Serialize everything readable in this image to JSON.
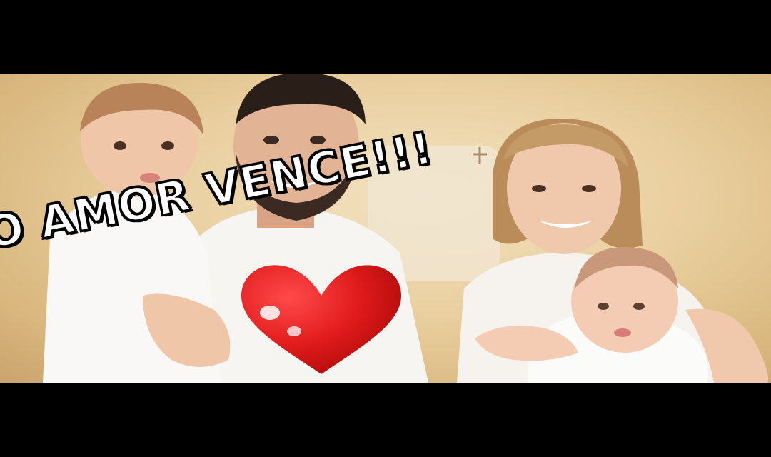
{
  "caption": {
    "text": "O AMOR VENCE!!!"
  },
  "colors": {
    "letterbox": "#000000",
    "background_wall": "#e9cf9f",
    "caption_fill": "#ffffff",
    "caption_outline": "#000000",
    "heart": "#e01a1a",
    "heart_highlight": "#ffffff"
  },
  "icons": {
    "heart": "heart-icon"
  }
}
